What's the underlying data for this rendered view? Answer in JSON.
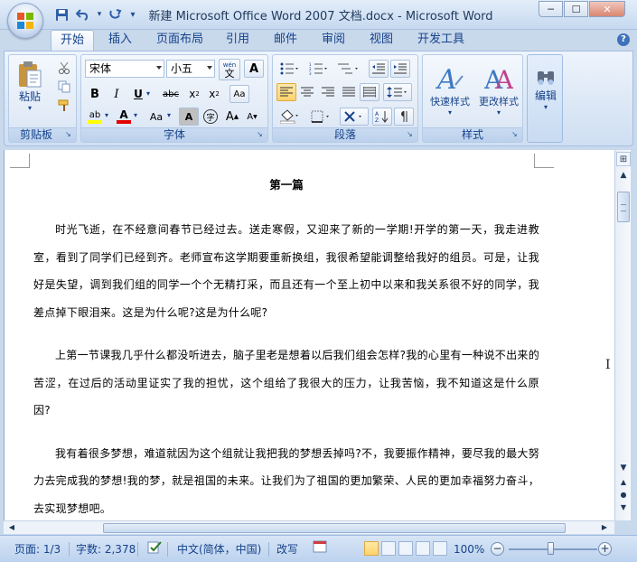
{
  "window": {
    "title": "新建 Microsoft Office Word 2007 文档.docx - Microsoft Word",
    "controls": {
      "minimize": "─",
      "maximize": "☐",
      "close": "✕"
    }
  },
  "qat": {
    "save_icon": "save-icon",
    "undo_icon": "undo-icon",
    "redo_icon": "redo-icon",
    "customize": "▾"
  },
  "ribbon": {
    "tabs": [
      "开始",
      "插入",
      "页面布局",
      "引用",
      "邮件",
      "审阅",
      "视图",
      "开发工具"
    ],
    "active_tab": "开始",
    "help": "?",
    "groups": {
      "clipboard": {
        "label": "剪贴板",
        "paste_label": "粘贴"
      },
      "font": {
        "label": "字体",
        "font_name": "宋体",
        "font_size": "小五",
        "wen": "wén",
        "wen_char": "文",
        "bold": "B",
        "italic": "I",
        "underline": "U",
        "strike": "abc",
        "subscript": "x",
        "superscript": "x",
        "change_case": "Aa",
        "grow": "A",
        "shrink": "A",
        "char_border": "A",
        "enclose": "字",
        "clear_fmt": "Aa"
      },
      "paragraph": {
        "label": "段落"
      },
      "styles": {
        "label": "样式",
        "quick_styles": "快速样式",
        "change_styles": "更改样式"
      },
      "editing": {
        "label": "编辑"
      }
    },
    "colors": {
      "accent": "#15428b",
      "highlight": "#ffd36b",
      "font_color_bar": "#e00000",
      "highlight_bar": "#ffff00"
    }
  },
  "document": {
    "title": "第一篇",
    "paragraphs": [
      "时光飞逝，在不经意间春节已经过去。送走寒假，又迎来了新的一学期!开学的第一天，我走进教室，看到了同学们已经到齐。老师宣布这学期要重新换组，我很希望能调整给我好的组员。可是，让我好是失望，调到我们组的同学一个个无精打采，而且还有一个至上初中以来和我关系很不好的同学，我差点掉下眼泪来。这是为什么呢?这是为什么呢?",
      "上第一节课我几乎什么都没听进去，脑子里老是想着以后我们组会怎样?我的心里有一种说不出来的苦涩，在过后的活动里证实了我的担忧，这个组给了我很大的压力，让我苦恼，我不知道这是什么原因?",
      "我有着很多梦想，难道就因为这个组就让我把我的梦想丢掉吗?不，我要振作精神，要尽我的最大努力去完成我的梦想!我的梦，就是祖国的未来。让我们为了祖国的更加繁荣、人民的更加幸福努力奋斗，去实现梦想吧。"
    ]
  },
  "statusbar": {
    "page": "页面: 1/3",
    "words": "字数: 2,378",
    "language": "中文(简体，中国)",
    "mode": "改写",
    "zoom": "100%",
    "zoom_minus": "−",
    "zoom_plus": "+",
    "zoom_level": 1.0
  }
}
